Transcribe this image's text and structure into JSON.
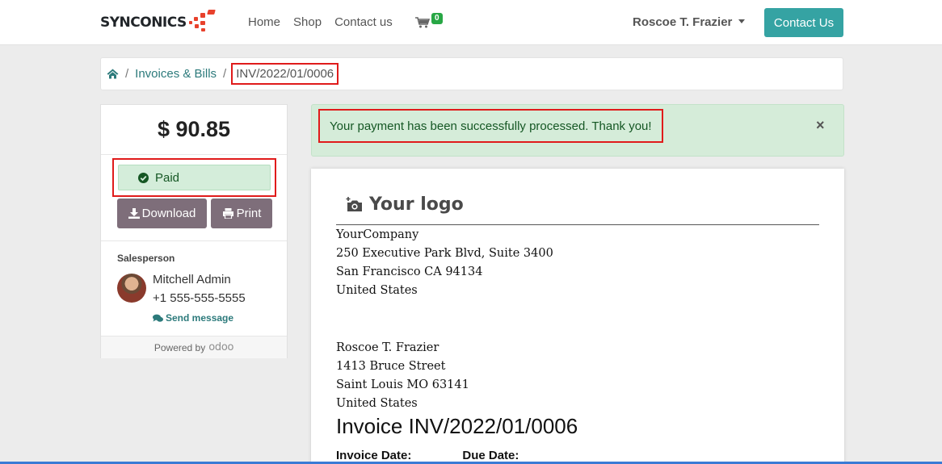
{
  "header": {
    "brand_main": "SYNCONICS",
    "nav": [
      "Home",
      "Shop",
      "Contact us"
    ],
    "cart_count": "0",
    "user_name": "Roscoe T. Frazier",
    "contact_button": "Contact Us"
  },
  "breadcrumb": {
    "home_icon": "home-icon",
    "separator": "/",
    "items": [
      "Invoices & Bills",
      "INV/2022/01/0006"
    ]
  },
  "sidebar": {
    "amount": "$ 90.85",
    "status": "Paid",
    "download_label": "Download",
    "print_label": "Print",
    "salesperson_label": "Salesperson",
    "salesperson_name": "Mitchell Admin",
    "salesperson_phone": "+1 555-555-5555",
    "send_message": "Send message",
    "powered_by": "Powered by",
    "powered_brand": "odoo"
  },
  "alert": {
    "message": "Your payment has been successfully processed. Thank you!",
    "close": "×"
  },
  "document": {
    "logo_text": "Your logo",
    "company": [
      "YourCompany",
      "250 Executive Park Blvd, Suite 3400",
      "San Francisco CA 94134",
      "United States"
    ],
    "customer": [
      "Roscoe T. Frazier",
      "1413 Bruce Street",
      "Saint Louis MO 63141",
      "United States"
    ],
    "invoice_title": "Invoice INV/2022/01/0006",
    "invoice_date_label": "Invoice Date:",
    "due_date_label": "Due Date:"
  },
  "colors": {
    "accent": "#35a3a3",
    "button": "#7e6e7a",
    "success_bg": "#d5ecd9",
    "highlight": "#e01b1b"
  }
}
